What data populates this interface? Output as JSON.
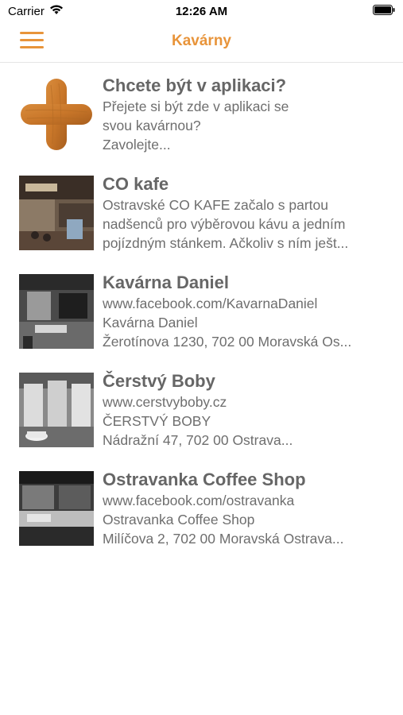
{
  "status_bar": {
    "carrier": "Carrier",
    "time": "12:26 AM"
  },
  "nav": {
    "title": "Kavárny",
    "menu_icon": "hamburger-menu-icon"
  },
  "items": [
    {
      "title": "Chcete být v aplikaci?",
      "lines": [
        "Přejete si být zde v aplikaci se",
        "svou kavárnou?",
        "Zavolejte..."
      ],
      "thumb": "wooden-plus-icon"
    },
    {
      "title": "CO kafe",
      "lines": [
        "Ostravské CO KAFE začalo s partou",
        "nadšenců pro výběrovou kávu a jedním",
        "pojízdným stánkem. Ačkoliv s ním ješt..."
      ],
      "thumb": "cafe-interior-photo"
    },
    {
      "title": "Kavárna Daniel",
      "lines": [
        "www.facebook.com/KavarnaDaniel",
        "Kavárna Daniel",
        "Žerotínova 1230, 702 00 Moravská Os..."
      ],
      "thumb": "cafe-bw-photo"
    },
    {
      "title": "Čerstvý Boby",
      "lines": [
        "www.cerstvyboby.cz",
        "ČERSTVÝ BOBY",
        "Nádražní 47, 702 00 Ostrava..."
      ],
      "thumb": "coffee-bags-photo"
    },
    {
      "title": "Ostravanka Coffee Shop",
      "lines": [
        "www.facebook.com/ostravanka",
        "Ostravanka Coffee Shop",
        "Milíčova 2, 702 00 Moravská Ostrava..."
      ],
      "thumb": "coffee-shop-counter-photo"
    }
  ]
}
